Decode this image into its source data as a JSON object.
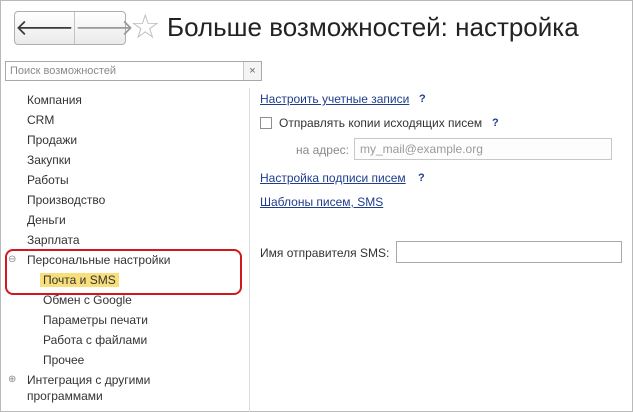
{
  "header": {
    "back_symbol": "🡐",
    "forward_symbol": "🡒",
    "favorite_symbol": "☆",
    "title": "Больше возможностей: настройка"
  },
  "search": {
    "placeholder": "Поиск возможностей",
    "clear_symbol": "×"
  },
  "sidebar": {
    "items": [
      {
        "label": "Компания"
      },
      {
        "label": "CRM"
      },
      {
        "label": "Продажи"
      },
      {
        "label": "Закупки"
      },
      {
        "label": "Работы"
      },
      {
        "label": "Производство"
      },
      {
        "label": "Деньги"
      },
      {
        "label": "Зарплата"
      },
      {
        "label": "Персональные настройки",
        "toggle": "⊖"
      },
      {
        "label": "Почта и SMS",
        "selected": true
      },
      {
        "label": "Обмен с Google"
      },
      {
        "label": "Параметры печати"
      },
      {
        "label": "Работа с файлами"
      },
      {
        "label": "Прочее"
      },
      {
        "label": "Интеграция с другими",
        "toggle": "⊕"
      },
      {
        "label": "программами"
      }
    ]
  },
  "main": {
    "accounts_link": "Настроить учетные записи",
    "help_mark": "?",
    "send_copies_label": "Отправлять копии исходящих писем",
    "address_label": "на адрес:",
    "address_placeholder": "my_mail@example.org",
    "signature_link": "Настройка подписи писем",
    "templates_link": "Шаблоны писем, SMS",
    "sms_sender_label": "Имя отправителя SMS:",
    "sms_sender_value": ""
  },
  "colors": {
    "link": "#1f3d8c",
    "selection": "#f9df7a",
    "highlight_border": "#d2181d"
  }
}
